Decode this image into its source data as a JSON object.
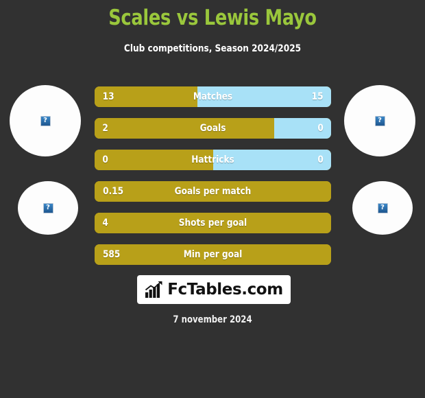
{
  "header": {
    "title": "Scales vs Lewis Mayo",
    "subtitle": "Club competitions, Season 2024/2025",
    "title_color": "#9ac73c"
  },
  "colors": {
    "background": "#313131",
    "left_player": "#b8a019",
    "right_player": "#a8e1f7",
    "title_green": "#9ac73c"
  },
  "avatars": [
    {
      "name": "left-player-photo-top",
      "placeholder_glyph": "?"
    },
    {
      "name": "left-player-photo-bottom",
      "placeholder_glyph": "?"
    },
    {
      "name": "right-player-photo-top",
      "placeholder_glyph": "?"
    },
    {
      "name": "right-player-photo-bottom",
      "placeholder_glyph": "?"
    }
  ],
  "chart_data": {
    "type": "bar",
    "title": "Scales vs Lewis Mayo",
    "subtitle": "Club competitions, Season 2024/2025",
    "orientation": "horizontal-diverging",
    "legend": [
      "Scales",
      "Lewis Mayo"
    ],
    "categories": [
      "Matches",
      "Goals",
      "Hattricks",
      "Goals per match",
      "Shots per goal",
      "Min per goal"
    ],
    "series": [
      {
        "name": "Scales",
        "color": "#b8a019",
        "values": [
          "13",
          "2",
          "0",
          "0.15",
          "4",
          "585"
        ]
      },
      {
        "name": "Lewis Mayo",
        "color": "#a8e1f7",
        "values": [
          "15",
          "0",
          "0",
          "",
          "",
          ""
        ]
      }
    ],
    "rows": [
      {
        "label": "Matches",
        "left_value": "13",
        "right_value": "15",
        "left_pct": 43.5,
        "right_pct": 56.5
      },
      {
        "label": "Goals",
        "left_value": "2",
        "right_value": "0",
        "left_pct": 76.0,
        "right_pct": 24.0
      },
      {
        "label": "Hattricks",
        "left_value": "0",
        "right_value": "0",
        "left_pct": 50.0,
        "right_pct": 50.0
      },
      {
        "label": "Goals per match",
        "left_value": "0.15",
        "right_value": "",
        "left_pct": 100.0,
        "right_pct": 0.0
      },
      {
        "label": "Shots per goal",
        "left_value": "4",
        "right_value": "",
        "left_pct": 100.0,
        "right_pct": 0.0
      },
      {
        "label": "Min per goal",
        "left_value": "585",
        "right_value": "",
        "left_pct": 100.0,
        "right_pct": 0.0
      }
    ]
  },
  "footer": {
    "logo_text": "FcTables.com",
    "logo_icon": "bar-chart-arrow-icon",
    "date": "7 november 2024"
  }
}
